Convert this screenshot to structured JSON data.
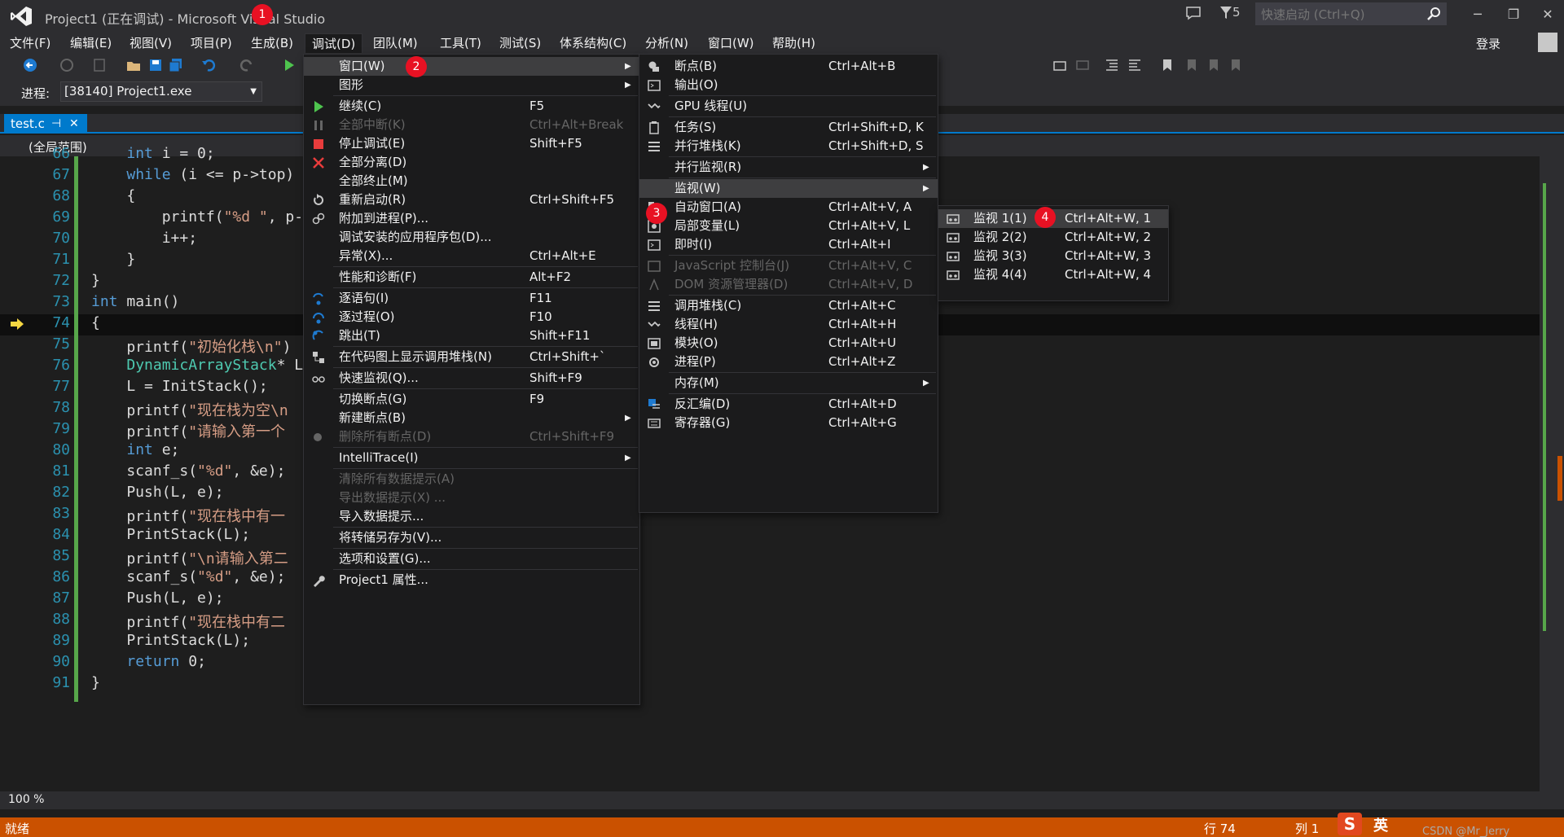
{
  "window": {
    "title": "Project1 (正在调试) - Microsoft Visual Studio",
    "filter_count": "5",
    "quick_launch_placeholder": "快速启动 (Ctrl+Q)",
    "login": "登录"
  },
  "badges": [
    "1",
    "2",
    "3",
    "4"
  ],
  "menubar": [
    {
      "label": "文件(F)"
    },
    {
      "label": "编辑(E)"
    },
    {
      "label": "视图(V)"
    },
    {
      "label": "项目(P)"
    },
    {
      "label": "生成(B)"
    },
    {
      "label": "调试(D)"
    },
    {
      "label": "团队(M)"
    },
    {
      "label": "工具(T)"
    },
    {
      "label": "测试(S)"
    },
    {
      "label": "体系结构(C)"
    },
    {
      "label": "分析(N)"
    },
    {
      "label": "窗口(W)"
    },
    {
      "label": "帮助(H)"
    }
  ],
  "toolbar": {
    "process_label": "进程:",
    "process_value": "[38140] Project1.exe"
  },
  "editor": {
    "tab_name": "test.c",
    "scope": "(全局范围)",
    "zoom": "100 %",
    "lines": [
      {
        "n": "66",
        "text": "    int i = 0;"
      },
      {
        "n": "67",
        "text": "    while (i <= p->top)"
      },
      {
        "n": "68",
        "text": "    {"
      },
      {
        "n": "69",
        "text": "        printf(\"%d \", p-"
      },
      {
        "n": "70",
        "text": "        i++;"
      },
      {
        "n": "71",
        "text": "    }"
      },
      {
        "n": "72",
        "text": "}"
      },
      {
        "n": "73",
        "text": "int main()"
      },
      {
        "n": "74",
        "text": "{"
      },
      {
        "n": "75",
        "text": "    printf(\"初始化栈\\n\")"
      },
      {
        "n": "76",
        "text": "    DynamicArrayStack* L"
      },
      {
        "n": "77",
        "text": "    L = InitStack();"
      },
      {
        "n": "78",
        "text": "    printf(\"现在栈为空\\n"
      },
      {
        "n": "79",
        "text": "    printf(\"请输入第一个"
      },
      {
        "n": "80",
        "text": "    int e;"
      },
      {
        "n": "81",
        "text": "    scanf_s(\"%d\", &e);"
      },
      {
        "n": "82",
        "text": "    Push(L, e);"
      },
      {
        "n": "83",
        "text": "    printf(\"现在栈中有一"
      },
      {
        "n": "84",
        "text": "    PrintStack(L);"
      },
      {
        "n": "85",
        "text": "    printf(\"\\n请输入第二"
      },
      {
        "n": "86",
        "text": "    scanf_s(\"%d\", &e);"
      },
      {
        "n": "87",
        "text": "    Push(L, e);"
      },
      {
        "n": "88",
        "text": "    printf(\"现在栈中有二"
      },
      {
        "n": "89",
        "text": "    PrintStack(L);"
      },
      {
        "n": "90",
        "text": "    return 0;"
      },
      {
        "n": "91",
        "text": "}"
      }
    ]
  },
  "debug_menu": [
    {
      "label": "窗口(W)",
      "shortcut": "",
      "submenu": true,
      "highlight": true
    },
    {
      "label": "图形",
      "shortcut": "",
      "submenu": true
    },
    {
      "label": "继续(C)",
      "shortcut": "F5",
      "icon": "play-icon"
    },
    {
      "label": "全部中断(K)",
      "shortcut": "Ctrl+Alt+Break",
      "disabled": true,
      "icon": "pause-icon"
    },
    {
      "label": "停止调试(E)",
      "shortcut": "Shift+F5",
      "icon": "stop-icon"
    },
    {
      "label": "全部分离(D)",
      "shortcut": "",
      "icon": "detach-icon"
    },
    {
      "label": "全部终止(M)",
      "shortcut": ""
    },
    {
      "label": "重新启动(R)",
      "shortcut": "Ctrl+Shift+F5",
      "icon": "restart-icon"
    },
    {
      "label": "附加到进程(P)...",
      "shortcut": "",
      "icon": "attach-icon"
    },
    {
      "label": "调试安装的应用程序包(D)...",
      "shortcut": ""
    },
    {
      "label": "异常(X)...",
      "shortcut": "Ctrl+Alt+E"
    },
    {
      "label": "性能和诊断(F)",
      "shortcut": "Alt+F2"
    },
    {
      "label": "逐语句(I)",
      "shortcut": "F11",
      "icon": "step-into-icon"
    },
    {
      "label": "逐过程(O)",
      "shortcut": "F10",
      "icon": "step-over-icon"
    },
    {
      "label": "跳出(T)",
      "shortcut": "Shift+F11",
      "icon": "step-out-icon"
    },
    {
      "label": "在代码图上显示调用堆栈(N)",
      "shortcut": "Ctrl+Shift+`",
      "icon": "codemap-icon"
    },
    {
      "label": "快速监视(Q)...",
      "shortcut": "Shift+F9",
      "icon": "glasses-icon"
    },
    {
      "label": "切换断点(G)",
      "shortcut": "F9"
    },
    {
      "label": "新建断点(B)",
      "shortcut": "",
      "submenu": true
    },
    {
      "label": "删除所有断点(D)",
      "shortcut": "Ctrl+Shift+F9",
      "disabled": true,
      "icon": "delete-breakpoints-icon"
    },
    {
      "label": "IntelliTrace(I)",
      "shortcut": "",
      "submenu": true
    },
    {
      "label": "清除所有数据提示(A)",
      "shortcut": "",
      "disabled": true
    },
    {
      "label": "导出数据提示(X) ...",
      "shortcut": "",
      "disabled": true
    },
    {
      "label": "导入数据提示...",
      "shortcut": ""
    },
    {
      "label": "将转储另存为(V)...",
      "shortcut": ""
    },
    {
      "label": "选项和设置(G)...",
      "shortcut": ""
    },
    {
      "label": "Project1 属性...",
      "shortcut": "",
      "icon": "wrench-icon"
    }
  ],
  "window_menu": [
    {
      "label": "断点(B)",
      "shortcut": "Ctrl+Alt+B",
      "icon": "breakpoints-icon"
    },
    {
      "label": "输出(O)",
      "shortcut": "",
      "icon": "output-icon"
    },
    {
      "label": "GPU 线程(U)",
      "shortcut": "",
      "icon": "gpu-threads-icon"
    },
    {
      "label": "任务(S)",
      "shortcut": "Ctrl+Shift+D, K",
      "icon": "tasks-icon"
    },
    {
      "label": "并行堆栈(K)",
      "shortcut": "Ctrl+Shift+D, S",
      "icon": "parallel-stacks-icon"
    },
    {
      "label": "并行监视(R)",
      "shortcut": "",
      "submenu": true
    },
    {
      "label": "监视(W)",
      "shortcut": "",
      "submenu": true,
      "highlight": true
    },
    {
      "label": "自动窗口(A)",
      "shortcut": "Ctrl+Alt+V, A",
      "icon": "autos-icon"
    },
    {
      "label": "局部变量(L)",
      "shortcut": "Ctrl+Alt+V, L",
      "icon": "locals-icon"
    },
    {
      "label": "即时(I)",
      "shortcut": "Ctrl+Alt+I",
      "icon": "immediate-icon"
    },
    {
      "label": "JavaScript 控制台(J)",
      "shortcut": "Ctrl+Alt+V, C",
      "disabled": true,
      "icon": "js-console-icon"
    },
    {
      "label": "DOM 资源管理器(D)",
      "shortcut": "Ctrl+Alt+V, D",
      "disabled": true,
      "icon": "dom-explorer-icon"
    },
    {
      "label": "调用堆栈(C)",
      "shortcut": "Ctrl+Alt+C",
      "icon": "call-stack-icon"
    },
    {
      "label": "线程(H)",
      "shortcut": "Ctrl+Alt+H",
      "icon": "threads-icon"
    },
    {
      "label": "模块(O)",
      "shortcut": "Ctrl+Alt+U",
      "icon": "modules-icon"
    },
    {
      "label": "进程(P)",
      "shortcut": "Ctrl+Alt+Z",
      "icon": "processes-icon"
    },
    {
      "label": "内存(M)",
      "shortcut": "",
      "submenu": true
    },
    {
      "label": "反汇编(D)",
      "shortcut": "Ctrl+Alt+D",
      "icon": "disassembly-icon"
    },
    {
      "label": "寄存器(G)",
      "shortcut": "Ctrl+Alt+G",
      "icon": "registers-icon"
    }
  ],
  "watch_menu": [
    {
      "label": "监视 1(1)",
      "shortcut": "Ctrl+Alt+W, 1",
      "highlight": true
    },
    {
      "label": "监视 2(2)",
      "shortcut": "Ctrl+Alt+W, 2"
    },
    {
      "label": "监视 3(3)",
      "shortcut": "Ctrl+Alt+W, 3"
    },
    {
      "label": "监视 4(4)",
      "shortcut": "Ctrl+Alt+W, 4"
    }
  ],
  "status": {
    "ready": "就绪",
    "line": "行 74",
    "col": "列 1"
  },
  "ime": {
    "mode": "英",
    "watermark": "CSDN @Mr_Jerry"
  },
  "colors": {
    "accent": "#007acc",
    "status_debug": "#ca5100",
    "badge": "#e81123",
    "menu_bg": "#1b1b1c",
    "highlight": "#3e3e40"
  }
}
